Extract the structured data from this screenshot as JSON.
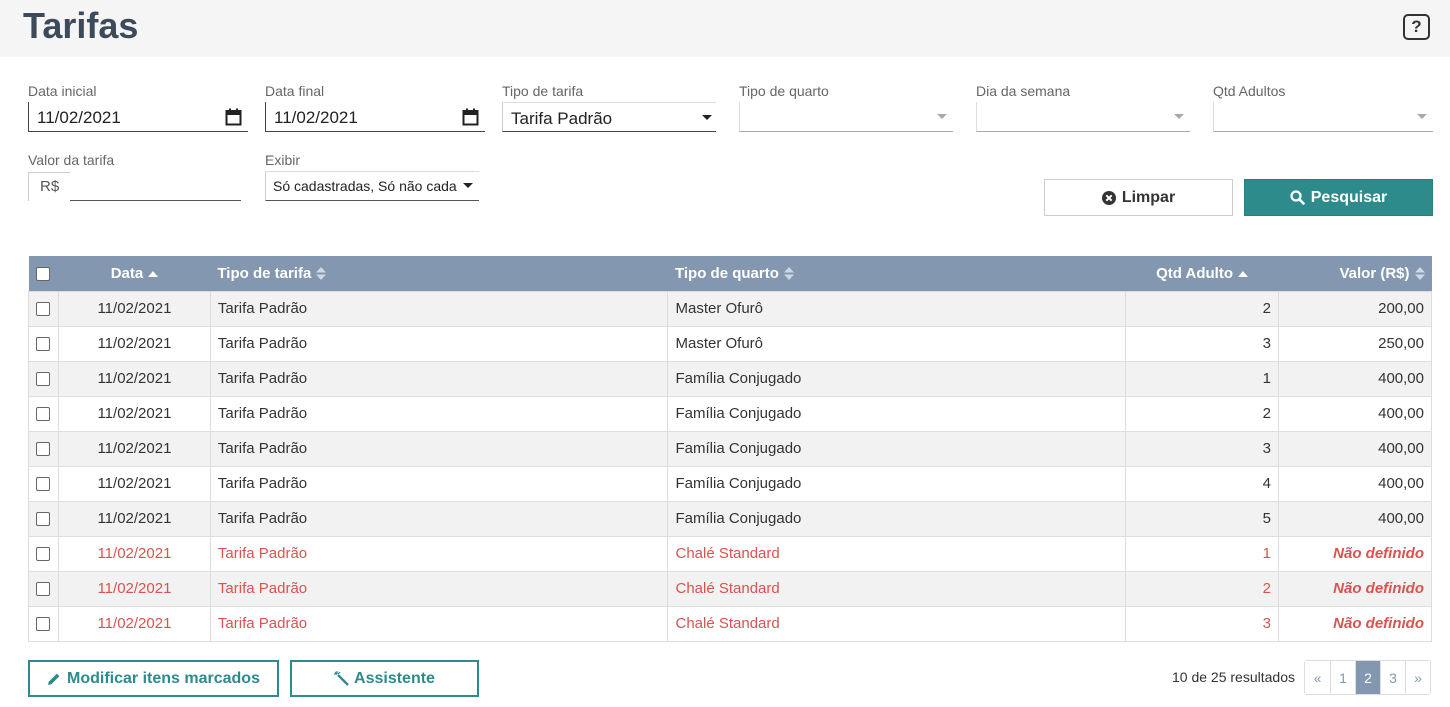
{
  "header": {
    "title": "Tarifas",
    "help_label": "?"
  },
  "filters": {
    "data_inicial": {
      "label": "Data inicial",
      "value": "11/02/2021"
    },
    "data_final": {
      "label": "Data final",
      "value": "11/02/2021"
    },
    "tipo_tarifa": {
      "label": "Tipo de tarifa",
      "value": "Tarifa Padrão"
    },
    "tipo_quarto": {
      "label": "Tipo de quarto",
      "value": ""
    },
    "dia_semana": {
      "label": "Dia da semana",
      "value": ""
    },
    "qtd_adultos": {
      "label": "Qtd Adultos",
      "value": ""
    },
    "valor_tarifa": {
      "label": "Valor da tarifa",
      "prefix": "R$",
      "value": ""
    },
    "exibir": {
      "label": "Exibir",
      "value": "Só cadastradas, Só não cada"
    }
  },
  "actions": {
    "clear_label": "Limpar",
    "search_label": "Pesquisar"
  },
  "table": {
    "headers": {
      "data": "Data",
      "tipo_tarifa": "Tipo de tarifa",
      "tipo_quarto": "Tipo de quarto",
      "qtd_adulto": "Qtd Adulto",
      "valor": "Valor (R$)"
    },
    "rows": [
      {
        "data": "11/02/2021",
        "tarifa": "Tarifa Padrão",
        "quarto": "Master Ofurô",
        "adultos": "2",
        "valor": "200,00",
        "undefined": false
      },
      {
        "data": "11/02/2021",
        "tarifa": "Tarifa Padrão",
        "quarto": "Master Ofurô",
        "adultos": "3",
        "valor": "250,00",
        "undefined": false
      },
      {
        "data": "11/02/2021",
        "tarifa": "Tarifa Padrão",
        "quarto": "Família Conjugado",
        "adultos": "1",
        "valor": "400,00",
        "undefined": false
      },
      {
        "data": "11/02/2021",
        "tarifa": "Tarifa Padrão",
        "quarto": "Família Conjugado",
        "adultos": "2",
        "valor": "400,00",
        "undefined": false
      },
      {
        "data": "11/02/2021",
        "tarifa": "Tarifa Padrão",
        "quarto": "Família Conjugado",
        "adultos": "3",
        "valor": "400,00",
        "undefined": false
      },
      {
        "data": "11/02/2021",
        "tarifa": "Tarifa Padrão",
        "quarto": "Família Conjugado",
        "adultos": "4",
        "valor": "400,00",
        "undefined": false
      },
      {
        "data": "11/02/2021",
        "tarifa": "Tarifa Padrão",
        "quarto": "Família Conjugado",
        "adultos": "5",
        "valor": "400,00",
        "undefined": false
      },
      {
        "data": "11/02/2021",
        "tarifa": "Tarifa Padrão",
        "quarto": "Chalé Standard",
        "adultos": "1",
        "valor": "Não definido",
        "undefined": true
      },
      {
        "data": "11/02/2021",
        "tarifa": "Tarifa Padrão",
        "quarto": "Chalé Standard",
        "adultos": "2",
        "valor": "Não definido",
        "undefined": true
      },
      {
        "data": "11/02/2021",
        "tarifa": "Tarifa Padrão",
        "quarto": "Chalé Standard",
        "adultos": "3",
        "valor": "Não definido",
        "undefined": true
      }
    ]
  },
  "footer": {
    "modify_label": "Modificar itens marcados",
    "assistant_label": "Assistente",
    "results_text": "10 de 25 resultados",
    "pagination": {
      "prev": "«",
      "pages": [
        "1",
        "2",
        "3"
      ],
      "active": "2",
      "next": "»"
    }
  },
  "colors": {
    "accent": "#2e8b8b",
    "table_header": "#8497b0",
    "undefined_text": "#d9534f"
  }
}
